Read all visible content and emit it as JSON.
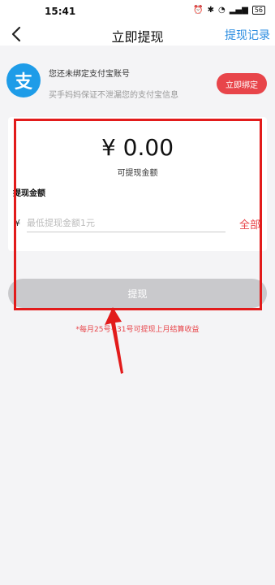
{
  "status_bar": {
    "time": "15:41",
    "icons": [
      "alarm-icon",
      "battery-saver-icon",
      "bluetooth-icon",
      "wifi-icon",
      "hd-icon",
      "signal-icon"
    ],
    "battery": "56"
  },
  "nav": {
    "back_icon": "chevron-left-icon",
    "title": "立即提现",
    "right_link": "提现记录"
  },
  "bind_card": {
    "logo_char": "支",
    "title": "您还未绑定支付宝账号",
    "subtitle": "买手妈妈保证不泄漏您的支付宝信息",
    "button": "立即绑定"
  },
  "balance": {
    "amount": "¥ 0.00",
    "label": "可提现金额"
  },
  "withdraw_form": {
    "section_label": "提现金额",
    "currency": "¥",
    "input_value": "",
    "input_placeholder": "最低提现金额1元",
    "all_label": "全部",
    "submit_label": "提现"
  },
  "note": "*每月25号~31号可提现上月结算收益",
  "colors": {
    "accent_red": "#e8454a",
    "link_blue": "#2a8ce0",
    "alipay_blue": "#1e9ce8",
    "annotation_red": "#e21b1b"
  }
}
